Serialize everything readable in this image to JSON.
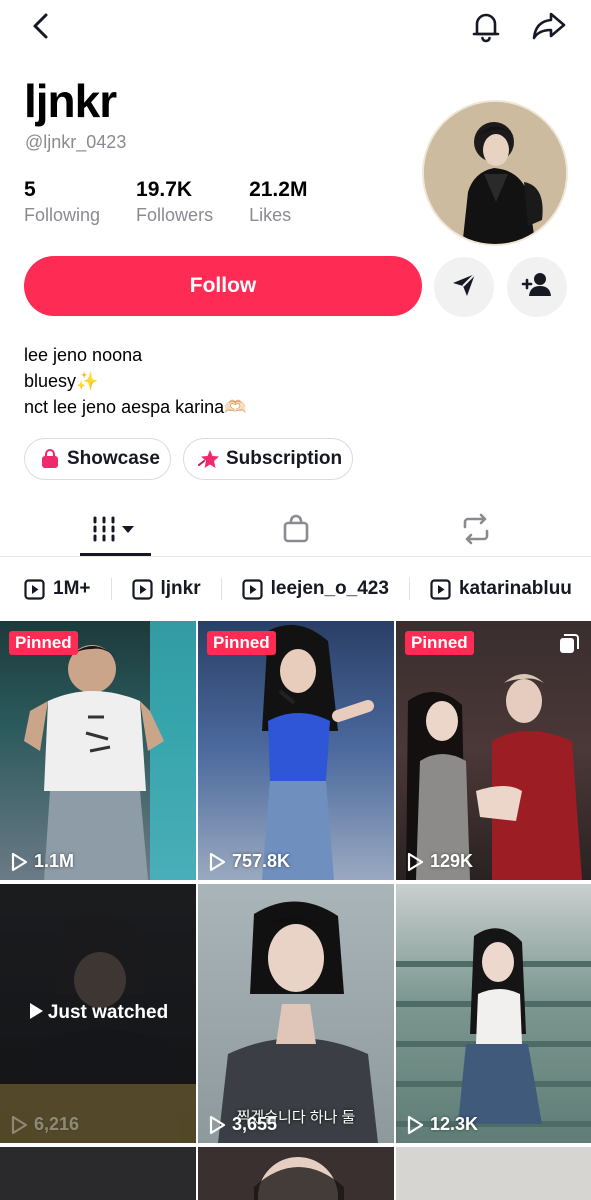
{
  "header": {
    "back_icon": "chevron-left-icon",
    "notification_icon": "bell-icon",
    "share_icon": "share-icon"
  },
  "profile": {
    "name": "ljnkr",
    "handle": "@ljnkr_0423",
    "stats": [
      {
        "value": "5",
        "label": "Following"
      },
      {
        "value": "19.7K",
        "label": "Followers"
      },
      {
        "value": "21.2M",
        "label": "Likes"
      }
    ]
  },
  "actions": {
    "follow_label": "Follow",
    "message_icon": "send-icon",
    "add_friend_icon": "add-user-icon"
  },
  "bio": {
    "lines": [
      "lee jeno noona",
      "bluesy✨",
      "nct lee jeno aespa karina🫶🏻"
    ]
  },
  "pills": [
    {
      "label": "Showcase",
      "icon": "shopping-bag-icon"
    },
    {
      "label": "Subscription",
      "icon": "star-icon"
    }
  ],
  "tabs": [
    {
      "name": "videos",
      "icon": "grid-icon",
      "active": true
    },
    {
      "name": "shop",
      "icon": "bag-icon",
      "active": false
    },
    {
      "name": "reposts",
      "icon": "repost-icon",
      "active": false
    }
  ],
  "playlists": [
    {
      "label": "1M+"
    },
    {
      "label": "ljnkr"
    },
    {
      "label": "leejen_o_423"
    },
    {
      "label": "katarinabluu"
    }
  ],
  "videos": [
    {
      "views": "1.1M",
      "pinned": true,
      "pinned_label": "Pinned"
    },
    {
      "views": "757.8K",
      "pinned": true,
      "pinned_label": "Pinned"
    },
    {
      "views": "129K",
      "pinned": true,
      "pinned_label": "Pinned"
    },
    {
      "views": "6,216",
      "overlay": "Just watched"
    },
    {
      "views": "3,655",
      "caption": "찍겠습니다 하나 둘"
    },
    {
      "views": "12.3K"
    }
  ],
  "colors": {
    "accent": "#fe2c55",
    "text_primary": "#161823",
    "text_secondary": "#8a8b91"
  }
}
